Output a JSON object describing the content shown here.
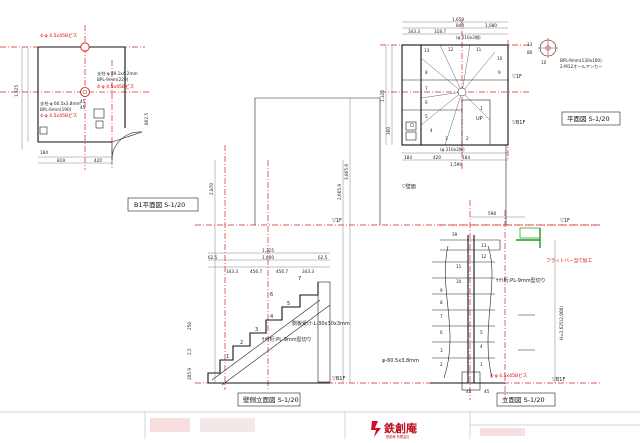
{
  "views": {
    "b1_plan": {
      "title": "B1平面図 S-1/20",
      "anchor_note_top": "4-φ 4.5x45Bビス",
      "pillar_spec": "支柱-φ 89.1x4.2mm",
      "bpl_spec": "BPL-9mm(220)",
      "anchor_note_mid": "4-φ 4.5x45Bビス",
      "post_spec": "支柱-φ 60.5x3.8mm",
      "bpl_spec_2": "BPL-6mm(190)",
      "anchor_note_low": "4-φ 4.5x45Bビス",
      "dims": [
        "1,325",
        "184",
        "819",
        "420",
        "862.5",
        "45",
        "45"
      ]
    },
    "top_plan": {
      "title": "平面図 S-1/20",
      "dims_top": [
        "1,659",
        "840",
        "1,080",
        "343.3",
        "318.7"
      ],
      "dim_top_center": "(φ 210x2側)",
      "dim_bottom_center": "(φ 210x2側)",
      "dims_bottom": [
        "184",
        "420",
        "184",
        "1,590"
      ],
      "dims_left": [
        "1,325",
        "360"
      ],
      "level_mark": "▽1F",
      "level_mark_2": "▽B1F",
      "up_label": "UP",
      "bpl_note": "BPL-9mm(130x100)",
      "anchor_note": "2-M12オールアンカー",
      "detail_nums": [
        "13",
        "80",
        "10"
      ],
      "step_nums": [
        "13",
        "12",
        "11",
        "10",
        "9",
        "8",
        "7",
        "6",
        "5",
        "4",
        "3",
        "2",
        "1"
      ]
    },
    "side_elevation": {
      "title": "壁側立面図 S-1/20",
      "dims_top": [
        "1,325",
        "62.5",
        "1,600",
        "62.5"
      ],
      "dims_step": [
        "343.3",
        "456.7",
        "456.7",
        "343.3"
      ],
      "dims_vertical": [
        "2,870",
        "2,665.9",
        "3,865.9"
      ],
      "level_1f": "▽1F",
      "level_b1f": "▽B1F",
      "angle_note": "側板受け:L-30x30x3mm",
      "stringer_note": "ｻｻﾗ桁:PL-9mm型切り",
      "heights": [
        "250",
        "2,5",
        "205.9"
      ],
      "step_nums": [
        "1",
        "2",
        "3",
        "4",
        "5",
        "6",
        "7"
      ]
    },
    "front_elevation": {
      "title": "立面図 S-1/20",
      "level_1f": "▽1F",
      "level_b1f": "▽B1F",
      "wall_label": "▽壁面",
      "dims_top": [
        "598",
        "39"
      ],
      "stringer_note": "ｻｻﾗ桁:PL-9mm型切り",
      "post_note": "φ-60.5x3.8mm",
      "anchor_note": "4-φ 4.5x45Bビス",
      "height_total": "H=2,625(2,900)",
      "red_note": "フラットバー当て加工",
      "bottom_dims": [
        "45",
        "45"
      ],
      "step_nums": [
        "13",
        "12",
        "11",
        "10",
        "9",
        "8",
        "7",
        "6",
        "5",
        "4",
        "3",
        "2",
        "1"
      ]
    }
  },
  "title_block": {
    "company": "鉄創庵",
    "company_sub": "鉄創庵 有限会社"
  },
  "colors": {
    "line": "#222222",
    "centerline": "#e02020",
    "accent_green": "#1a9a1a",
    "logo_red": "#d01020"
  }
}
